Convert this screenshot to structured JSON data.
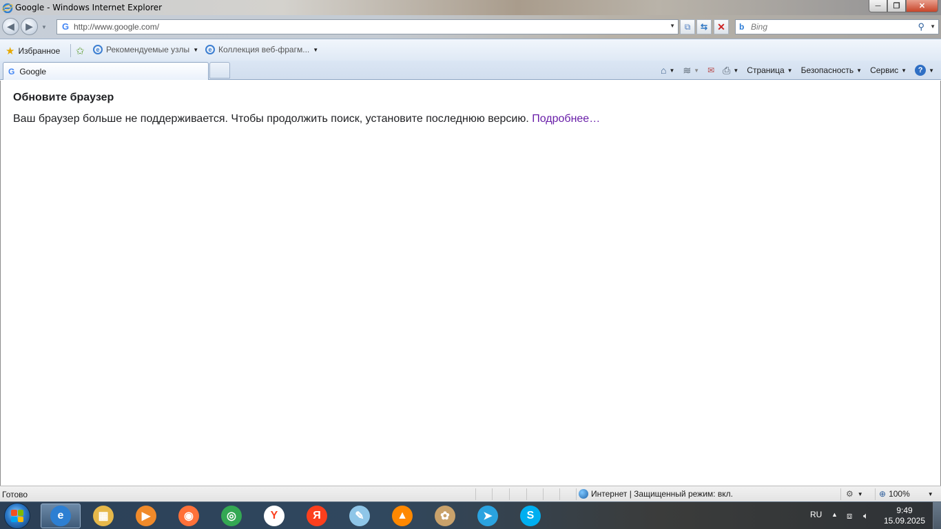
{
  "window": {
    "title": "Google - Windows Internet Explorer",
    "minimize_glyph": "─",
    "maximize_glyph": "❐",
    "close_glyph": "✕"
  },
  "navbar": {
    "back_glyph": "◀",
    "forward_glyph": "▶",
    "address_value": "http://www.google.com/",
    "search_placeholder": "Bing",
    "search_glyph": "⚲",
    "compat_glyph": "⧉",
    "refresh_glyph": "⇆",
    "stop_glyph": "✕"
  },
  "favorites": {
    "favorites_label": "Избранное",
    "items": [
      {
        "label": "Рекомендуемые узлы"
      },
      {
        "label": "Коллекция веб-фрагм..."
      }
    ]
  },
  "tabs": [
    {
      "label": "Google",
      "icon": "google-g-icon"
    }
  ],
  "commandbar": {
    "page_label": "Страница",
    "safety_label": "Безопасность",
    "tools_label": "Сервис",
    "help_glyph": "?"
  },
  "page": {
    "heading": "Обновите браузер",
    "message": "Ваш браузер больше не поддерживается. Чтобы продолжить поиск, установите последнюю версию. ",
    "link_text": "Подробнее…",
    "link_color": "#681da8"
  },
  "statusbar": {
    "status": "Готово",
    "zone": "Интернет | Защищенный режим: вкл.",
    "zoom": "100%"
  },
  "taskbar": {
    "apps": [
      {
        "name": "internet-explorer",
        "glyph": "e",
        "color": "#2d7fd2",
        "active": true
      },
      {
        "name": "file-explorer",
        "glyph": "▦",
        "color": "#e6b84a",
        "active": false
      },
      {
        "name": "media-player",
        "glyph": "▶",
        "color": "#f08a2a",
        "active": false
      },
      {
        "name": "firefox",
        "glyph": "◉",
        "color": "#ff7139",
        "active": false
      },
      {
        "name": "chrome",
        "glyph": "◎",
        "color": "#34a853",
        "active": false
      },
      {
        "name": "yandex-browser",
        "glyph": "Y",
        "color": "#ffffff",
        "active": false
      },
      {
        "name": "yandex",
        "glyph": "Я",
        "color": "#fc3f1d",
        "active": false
      },
      {
        "name": "notepad",
        "glyph": "✎",
        "color": "#8fc6e8",
        "active": false
      },
      {
        "name": "vlc",
        "glyph": "▲",
        "color": "#ff8800",
        "active": false
      },
      {
        "name": "paint",
        "glyph": "✿",
        "color": "#c9a26b",
        "active": false
      },
      {
        "name": "telegram",
        "glyph": "➤",
        "color": "#2aa3e0",
        "active": false
      },
      {
        "name": "skype",
        "glyph": "S",
        "color": "#00aff0",
        "active": false
      }
    ],
    "language": "RU",
    "time": "9:49",
    "date": "15.09.2025"
  }
}
